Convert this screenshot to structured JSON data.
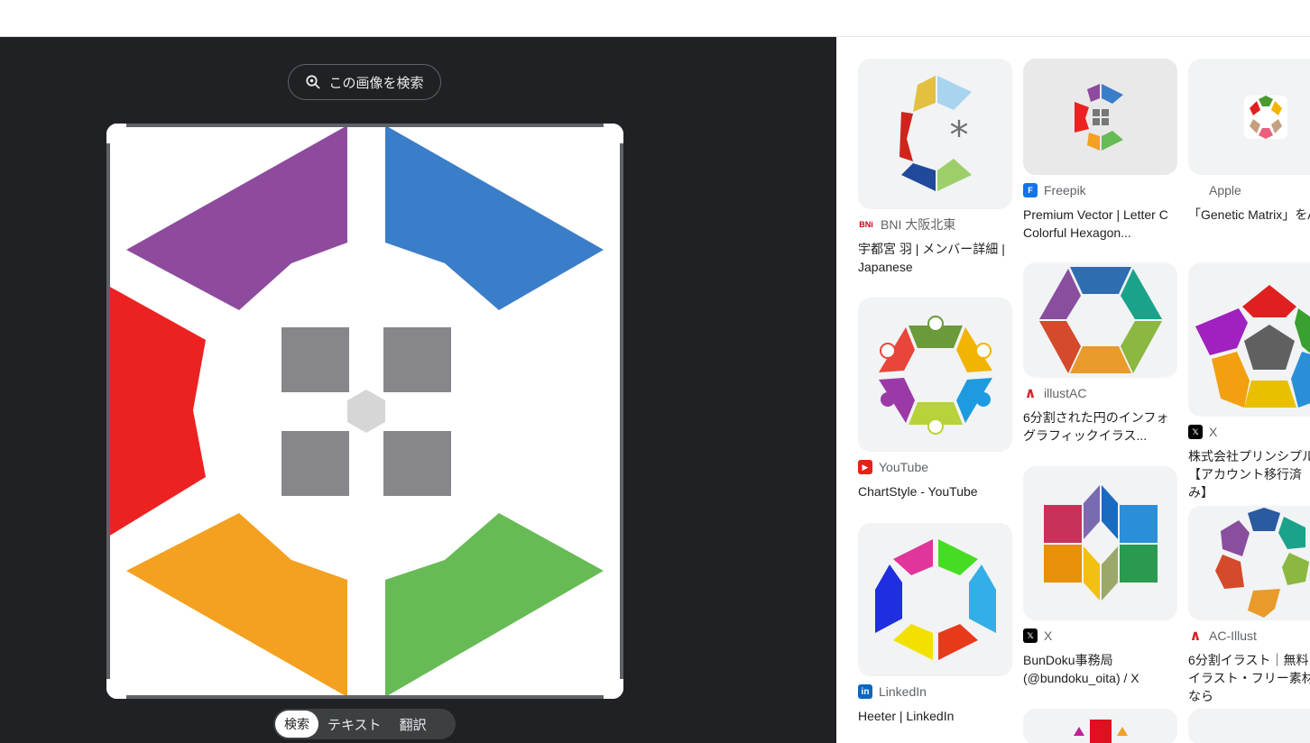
{
  "search_pill": {
    "label": "この画像を検索"
  },
  "modes": [
    "検索",
    "テキスト",
    "翻訳"
  ],
  "results": [
    {
      "source": "BNI 大阪北東",
      "favicon": "BNi",
      "title": "宇都宮 羽 | メンバー詳細 | Japanese"
    },
    {
      "source": "YouTube",
      "favicon": "youtube-icon",
      "title": "ChartStyle - YouTube"
    },
    {
      "source": "LinkedIn",
      "favicon": "in",
      "title": "Heeter | LinkedIn"
    },
    {
      "source": "Freepik",
      "favicon": "F",
      "title": "Premium Vector | Letter C Colorful Hexagon..."
    },
    {
      "source": "illustAC",
      "favicon": "illustac-icon",
      "title": "6分割された円のインフォグラフィックイラス..."
    },
    {
      "source": "X",
      "favicon": "x-icon",
      "title": "BunDoku事務局 (@bundoku_oita) / X"
    },
    {
      "source": "Apple",
      "favicon": "apple-icon",
      "title": "「Genetic Matrix」をApp Storeで"
    },
    {
      "source": "X",
      "favicon": "x-icon",
      "title": "株式会社プリンシプル【アカウント移行済み】"
    },
    {
      "source": "AC-Illust",
      "favicon": "acillust-icon",
      "title": "6分割イラスト｜無料イラスト・フリー素材なら"
    }
  ],
  "colors": {
    "dark_bg": "#202124",
    "purple": "#8e4b9e",
    "blue": "#3a7dc9",
    "red": "#ec2222",
    "orange": "#f4a020",
    "green": "#66bb55",
    "gray": "#888888"
  }
}
